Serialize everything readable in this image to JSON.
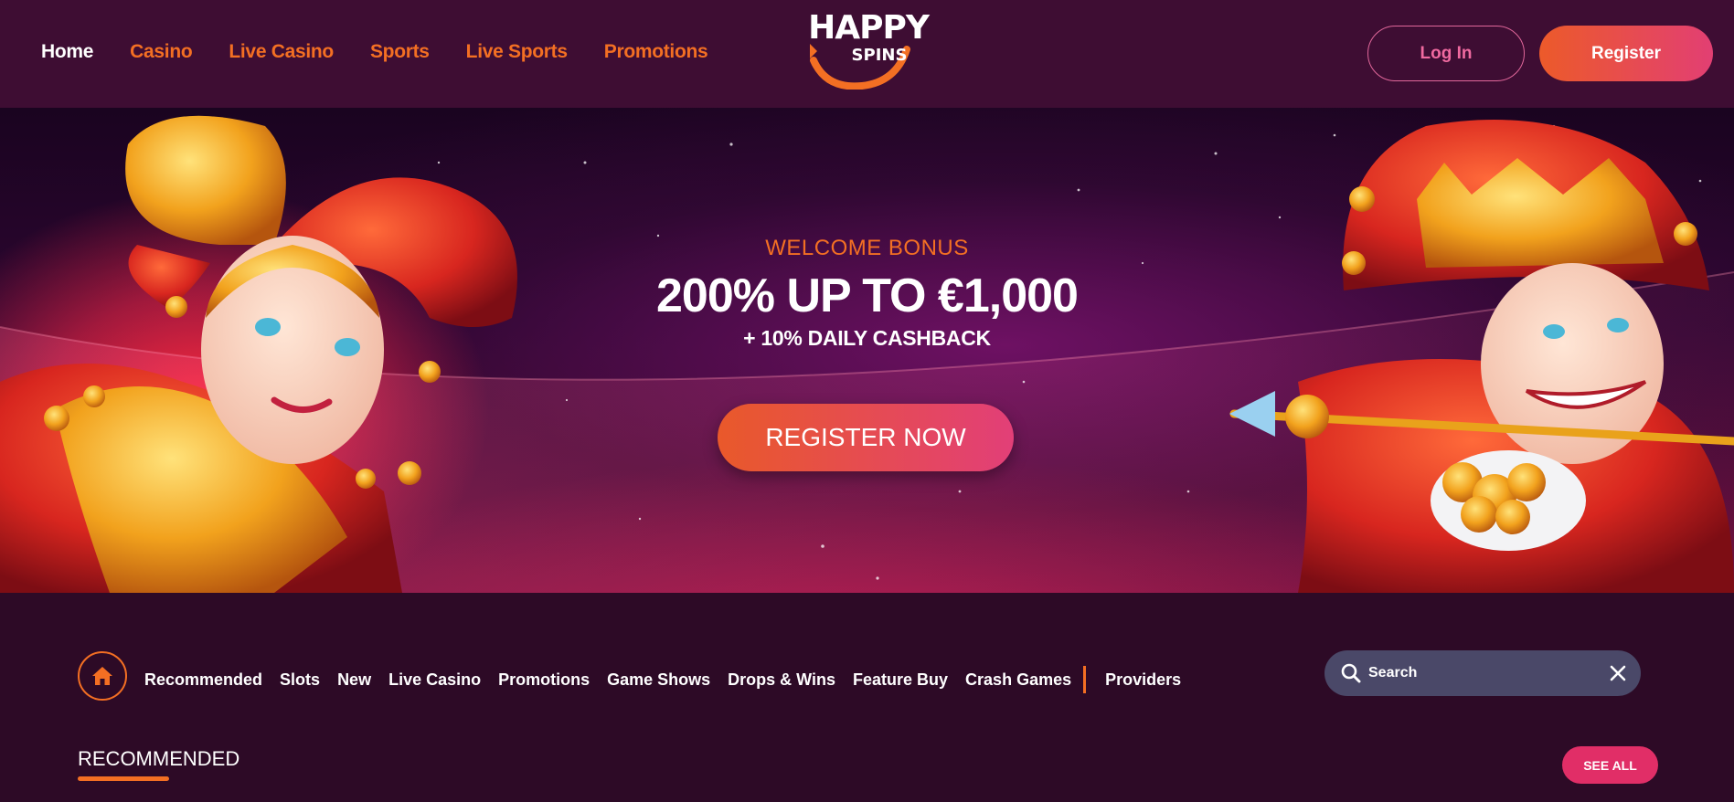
{
  "header": {
    "nav": [
      {
        "label": "Home",
        "active": true
      },
      {
        "label": "Casino",
        "active": false
      },
      {
        "label": "Live Casino",
        "active": false
      },
      {
        "label": "Sports",
        "active": false
      },
      {
        "label": "Live Sports",
        "active": false
      },
      {
        "label": "Promotions",
        "active": false
      }
    ],
    "logo": {
      "line1": "HAPPY",
      "line2": "SPINS"
    },
    "login_label": "Log In",
    "register_label": "Register"
  },
  "hero": {
    "eyebrow": "WELCOME BONUS",
    "headline": "200% UP TO €1,000",
    "subline": "+ 10% DAILY CASHBACK",
    "cta_label": "REGISTER NOW"
  },
  "categories": {
    "items": [
      "Recommended",
      "Slots",
      "New",
      "Live Casino",
      "Promotions",
      "Game Shows",
      "Drops & Wins",
      "Feature Buy",
      "Crash Games"
    ],
    "providers_label": "Providers"
  },
  "search": {
    "value": "Search"
  },
  "section": {
    "title": "RECOMMENDED",
    "see_all_label": "SEE ALL"
  },
  "colors": {
    "accent_orange": "#f36f23",
    "accent_pink": "#e12e67",
    "header_bg": "#3e0d33",
    "page_bg": "#2d0a26",
    "search_bg": "#4a4868"
  },
  "icons": [
    "home-icon",
    "search-icon",
    "close-icon",
    "logo-arc-icon"
  ]
}
